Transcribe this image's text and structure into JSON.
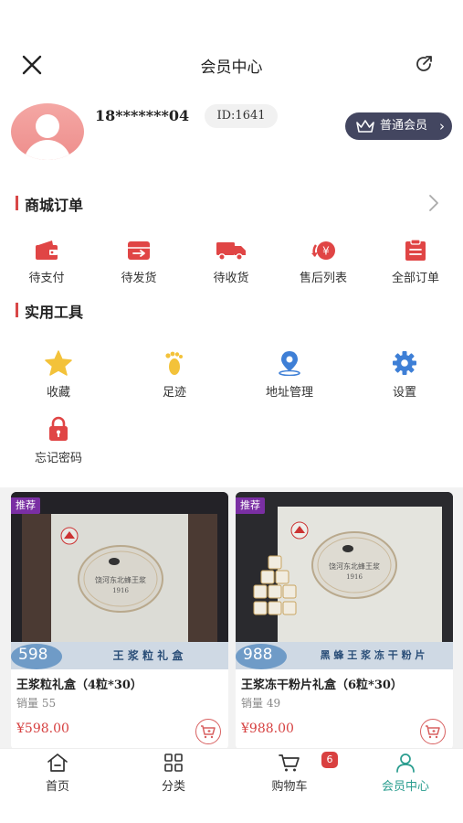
{
  "header": {
    "title": "会员中心"
  },
  "profile": {
    "phone": "18*******04",
    "id_label": "ID:1641",
    "member_level": "普通会员"
  },
  "orders": {
    "title": "商城订单",
    "items": [
      {
        "label": "待支付",
        "icon": "wallet-icon"
      },
      {
        "label": "待发货",
        "icon": "box-icon"
      },
      {
        "label": "待收货",
        "icon": "truck-icon"
      },
      {
        "label": "售后列表",
        "icon": "refund-icon"
      },
      {
        "label": "全部订单",
        "icon": "order-list-icon"
      }
    ]
  },
  "tools": {
    "title": "实用工具",
    "items": [
      {
        "label": "收藏",
        "icon": "star-icon"
      },
      {
        "label": "足迹",
        "icon": "footprint-icon"
      },
      {
        "label": "地址管理",
        "icon": "location-pin-icon"
      },
      {
        "label": "设置",
        "icon": "gear-icon"
      },
      {
        "label": "忘记密码",
        "icon": "lock-icon"
      }
    ]
  },
  "products": [
    {
      "tag": "推荐",
      "name": "王浆粒礼盒（4粒*30）",
      "sales_label": "销量",
      "sales": "55",
      "price": "¥598.00",
      "price_badge": "598",
      "banner": "王 浆 粒 礼 盒",
      "seal_line": "饶河东北蜂王浆",
      "year": "1916"
    },
    {
      "tag": "推荐",
      "name": "王浆冻干粉片礼盒（6粒*30）",
      "sales_label": "销量",
      "sales": "49",
      "price": "¥988.00",
      "price_badge": "988",
      "banner": "黑 蜂 王 浆 冻 干 粉 片",
      "seal_line": "饶河东北蜂王浆",
      "year": "1916"
    }
  ],
  "tabbar": {
    "items": [
      {
        "label": "首页",
        "icon": "home-icon"
      },
      {
        "label": "分类",
        "icon": "grid-icon"
      },
      {
        "label": "购物车",
        "icon": "cart-icon"
      },
      {
        "label": "会员中心",
        "icon": "user-icon"
      }
    ],
    "cart_count": "6",
    "active_color": "#2a9d8f"
  },
  "colors": {
    "accent_red": "#d94040",
    "member_badge_bg": "#434660",
    "icon_blue": "#3e7fd6",
    "icon_yellow": "#f3c23a"
  }
}
